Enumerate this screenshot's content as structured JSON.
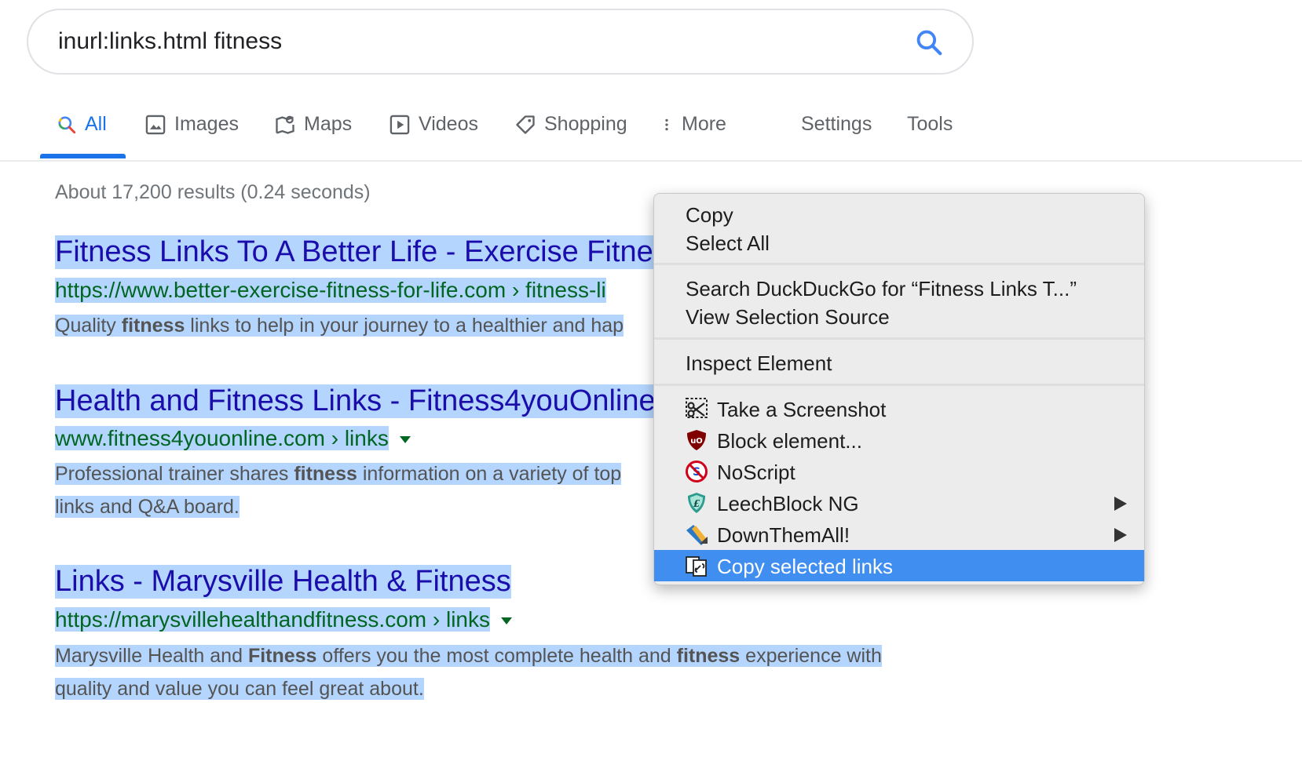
{
  "search": {
    "query": "inurl:links.html fitness"
  },
  "tabs": [
    {
      "label": "All",
      "icon": "search-icon",
      "active": true
    },
    {
      "label": "Images",
      "icon": "image-icon"
    },
    {
      "label": "Maps",
      "icon": "map-icon"
    },
    {
      "label": "Videos",
      "icon": "video-icon"
    },
    {
      "label": "Shopping",
      "icon": "tag-icon"
    },
    {
      "label": "More",
      "icon": "more-vertical-icon"
    },
    {
      "label": "Settings"
    },
    {
      "label": "Tools"
    }
  ],
  "result_stats": "About 17,200 results (0.24 seconds)",
  "results": [
    {
      "title": "Fitness Links To A Better Life - Exercise Fitne",
      "url": "https://www.better-exercise-fitness-for-life.com › fitness-li",
      "snippet_lines": [
        {
          "pre": "Quality ",
          "bold": "fitness",
          "post": " links to help in your journey to a healthier and hap"
        }
      ]
    },
    {
      "title": "Health and Fitness Links - Fitness4youOnline",
      "url": "www.fitness4youonline.com › links",
      "snippet_lines": [
        {
          "pre": "Professional trainer shares ",
          "bold": "fitness",
          "post": " information on a variety of top"
        },
        {
          "pre": "links and Q&A board.",
          "bold": "",
          "post": ""
        }
      ]
    },
    {
      "title": "Links - Marysville Health & Fitness",
      "url": "https://marysvillehealthandfitness.com › links",
      "snippet_lines": [
        {
          "pre": "Marysville Health and ",
          "bold": "Fitness",
          "post": " offers you the most complete health and ",
          "bold2": "fitness",
          "post2": " experience with"
        },
        {
          "pre": "quality and value you can feel great about.",
          "bold": "",
          "post": ""
        }
      ]
    }
  ],
  "context_menu": {
    "items": [
      {
        "label": "Copy"
      },
      {
        "label": "Select All"
      },
      {
        "label": "Search DuckDuckGo for “Fitness Links T...”"
      },
      {
        "label": "View Selection Source"
      },
      {
        "label": "Inspect Element"
      },
      {
        "label": "Take a Screenshot",
        "icon": "screenshot-scissors-icon"
      },
      {
        "label": "Block element...",
        "icon": "ublock-shield-icon"
      },
      {
        "label": "NoScript",
        "icon": "noscript-icon"
      },
      {
        "label": "LeechBlock NG",
        "icon": "leechblock-shield-icon",
        "submenu": true
      },
      {
        "label": "DownThemAll!",
        "icon": "downthemall-icon",
        "submenu": true
      },
      {
        "label": "Copy selected links",
        "icon": "copy-links-icon",
        "selected": true
      }
    ]
  },
  "colors": {
    "link_title": "#1a0dab",
    "link_url": "#006621",
    "selection_highlight": "#b4d5fe",
    "menu_selected": "#3f8ef0",
    "tab_active": "#1a73e8"
  }
}
